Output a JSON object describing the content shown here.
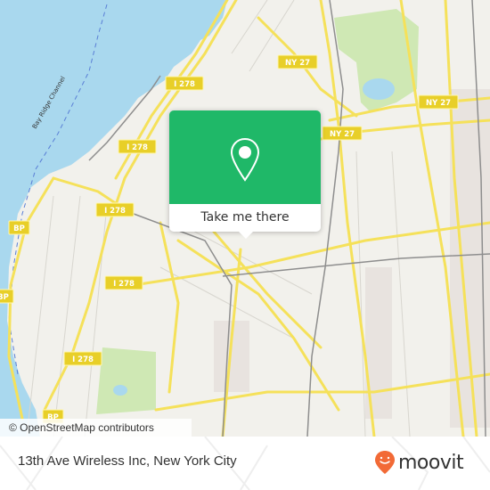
{
  "map": {
    "colors": {
      "land": "#f2f1ec",
      "water": "#a9d8ee",
      "park": "#cfe8b4",
      "road": "#f5e15a",
      "rail": "#8e8e8e",
      "accent": "#1fb868",
      "brand": "#f26a36"
    },
    "water_label": "Bay Ridge Channel",
    "shields": [
      {
        "id": "i278-a",
        "label": "I 278"
      },
      {
        "id": "i278-b",
        "label": "I 278"
      },
      {
        "id": "i278-c",
        "label": "I 278"
      },
      {
        "id": "i278-d",
        "label": "I 278"
      },
      {
        "id": "i278-e",
        "label": "I 278"
      },
      {
        "id": "i278-f",
        "label": "I 278"
      },
      {
        "id": "ny27-a",
        "label": "NY 27"
      },
      {
        "id": "ny27-b",
        "label": "NY 27"
      },
      {
        "id": "ny27-c",
        "label": "NY 27"
      },
      {
        "id": "bp-a",
        "label": "BP"
      },
      {
        "id": "bp-b",
        "label": "BP"
      },
      {
        "id": "bp-c",
        "label": "BP"
      }
    ],
    "attribution": "© OpenStreetMap contributors"
  },
  "popup": {
    "icon": "location-pin-icon",
    "cta_label": "Take me there"
  },
  "footer": {
    "place_name": "13th Ave Wireless Inc, New York City",
    "brand_name": "moovit",
    "brand_icon": "moovit-smiley-pin-icon"
  }
}
